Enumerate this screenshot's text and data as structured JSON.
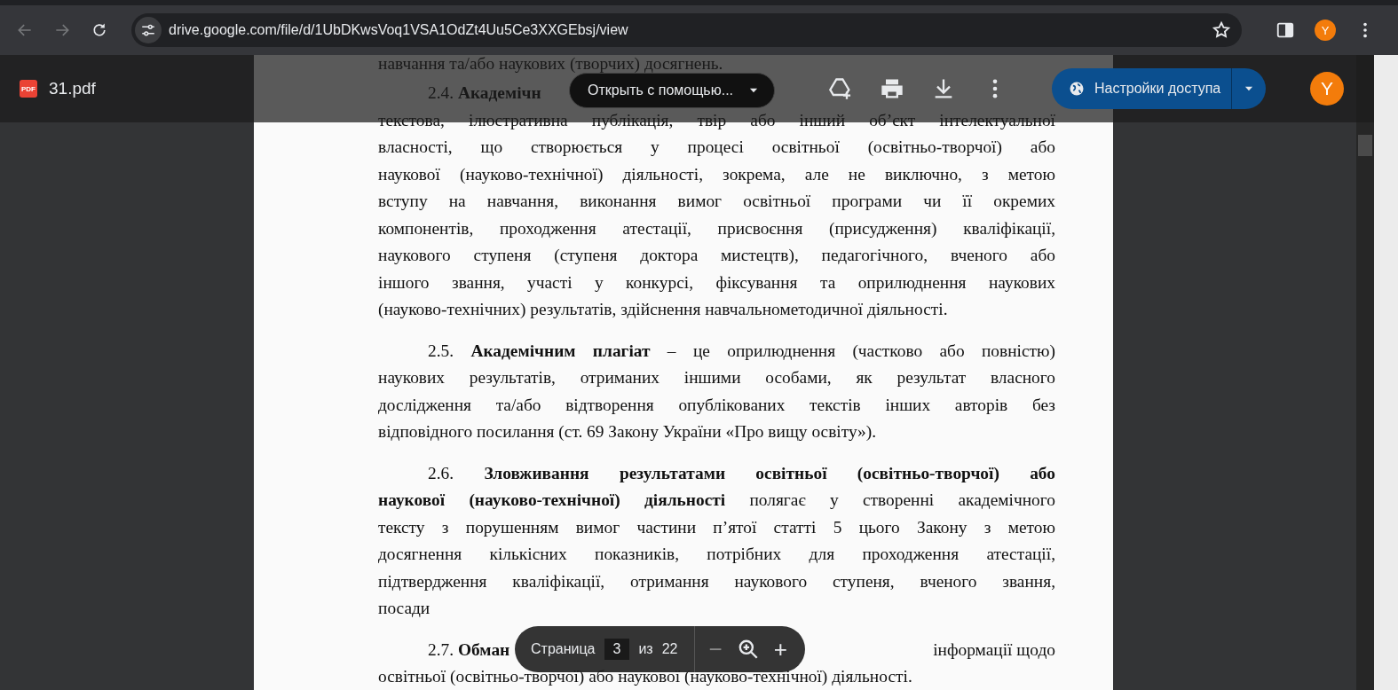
{
  "browser": {
    "nav_buttons": [
      {
        "kind": "back",
        "disabled": true
      },
      {
        "kind": "forward",
        "disabled": true
      },
      {
        "kind": "reload",
        "disabled": false
      }
    ],
    "url": "drive.google.com/file/d/1UbDKwsVoq1VSA1OdZt4Uu5Ce3XXGEbsj/view",
    "profile_initial": "Y"
  },
  "viewer": {
    "file_icon_label": "PDF",
    "file_name": "31.pdf",
    "open_with_button": "Открыть с помощью...",
    "toolbar_icons": [
      {
        "kind": "add-to-drive"
      },
      {
        "kind": "print"
      },
      {
        "kind": "download"
      },
      {
        "kind": "more"
      }
    ],
    "share_button": "Настройки доступа",
    "avatar_initial": "Y"
  },
  "document": {
    "paragraphs": [
      {
        "indent": false,
        "lines": [
          {
            "text": "навчання та/або наукових (творчих) досягнень."
          }
        ]
      },
      {
        "indent": true,
        "lines": [
          {
            "left": "2.4. **Академічн**"
          },
          {
            "text": "текстова, ілюстративна публікація, твір або інший об’єкт інтелектуальної"
          },
          {
            "text": "власності, що створюється у процесі освітньої (освітньо-творчої) або"
          },
          {
            "text": "наукової (науково-технічної) діяльності, зокрема, але не виключно, з метою"
          },
          {
            "text": "вступу на навчання, виконання вимог освітньої програми чи її окремих"
          },
          {
            "text": "компонентів, проходження атестації, присвоєння (присудження) кваліфікації,"
          },
          {
            "text": "наукового ступеня (ступеня доктора мистецтв), педагогічного, вченого або"
          },
          {
            "text": "іншого звання, участі у конкурсі, фіксування та оприлюднення наукових"
          },
          {
            "text": "(науково-технічних) результатів, здійснення навчальнометодичної діяльності."
          }
        ]
      },
      {
        "indent": true,
        "lines": [
          {
            "text": "2.5. **Академічним плагіат** – це оприлюднення (частково або повністю)"
          },
          {
            "text": "наукових результатів, отриманих іншими особами, як результат власного"
          },
          {
            "text": "дослідження та/або відтворення опублікованих текстів інших авторів без"
          },
          {
            "text": "відповідного посилання (ст. 69 Закону України «Про вищу освіту»)."
          }
        ]
      },
      {
        "indent": true,
        "lines": [
          {
            "text": "2.6. **Зловживання результатами освітньої (освітньо-творчої) або**"
          },
          {
            "text": "**наукової (науково-технічної) діяльності** полягає у створенні академічного"
          },
          {
            "text": "тексту з порушенням вимог частини п’ятої статті 5 цього Закону з метою"
          },
          {
            "text": "досягнення кількісних показників, потрібних для проходження атестації,"
          },
          {
            "text": "підтвердження кваліфікації, отримання наукового ступеня, вченого звання,"
          },
          {
            "text": "посади"
          }
        ]
      },
      {
        "indent": true,
        "lines": [
          {
            "left": "2.7. **Обман**",
            "right": "інформації щодо"
          },
          {
            "text": "освітньої (освітньо-творчої) або наукової (науково-технічної) діяльності."
          }
        ]
      }
    ]
  },
  "pager": {
    "label": "Страница",
    "current": "3",
    "of": "из",
    "total": "22",
    "zoom_out": "−",
    "zoom_in": "+"
  }
}
